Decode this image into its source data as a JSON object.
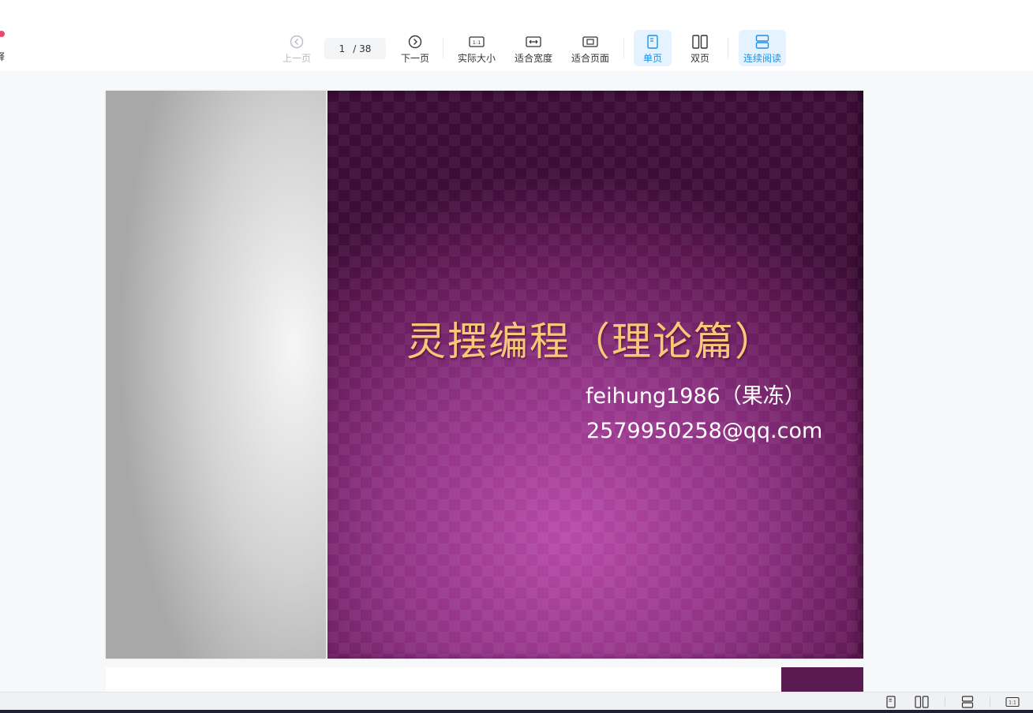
{
  "left_fragment": {
    "label": "释"
  },
  "toolbar": {
    "prev_label": "上一页",
    "page_current": "1",
    "page_total": "/ 38",
    "next_label": "下一页",
    "actual_size_label": "实际大小",
    "fit_width_label": "适合宽度",
    "fit_page_label": "适合页面",
    "single_page_label": "单页",
    "double_page_label": "双页",
    "continuous_label": "连续阅读"
  },
  "slide": {
    "title": "灵摆编程（理论篇）",
    "author": "feihung1986（果冻）",
    "email": "2579950258@qq.com"
  },
  "colors": {
    "accent": "#1e90e6",
    "active_bg": "#e4f3ff",
    "title_color": "#f8c779",
    "slide_purple": "#8f3284"
  }
}
